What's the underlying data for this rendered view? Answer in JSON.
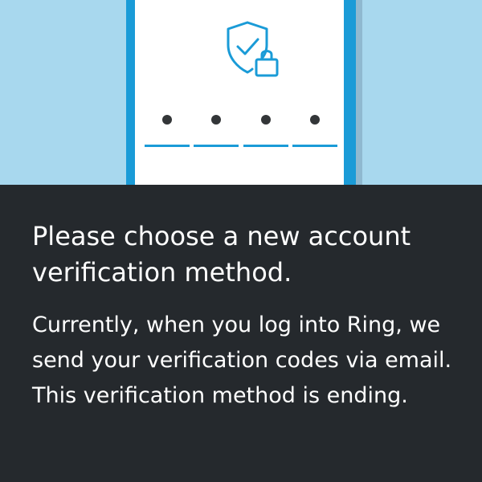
{
  "illustration": {
    "icon": "shield-lock-icon",
    "pin_digits_entered": 4,
    "colors": {
      "background": "#a8d8ee",
      "phone_frame": "#1a9bd7",
      "accent": "#1a9bd7"
    }
  },
  "content": {
    "title": "Please choose a new account verification method.",
    "body": "Currently, when you log into Ring, we send your verification codes via email. This verification method is ending."
  },
  "colors": {
    "background": "#25292d",
    "text": "#ffffff"
  }
}
